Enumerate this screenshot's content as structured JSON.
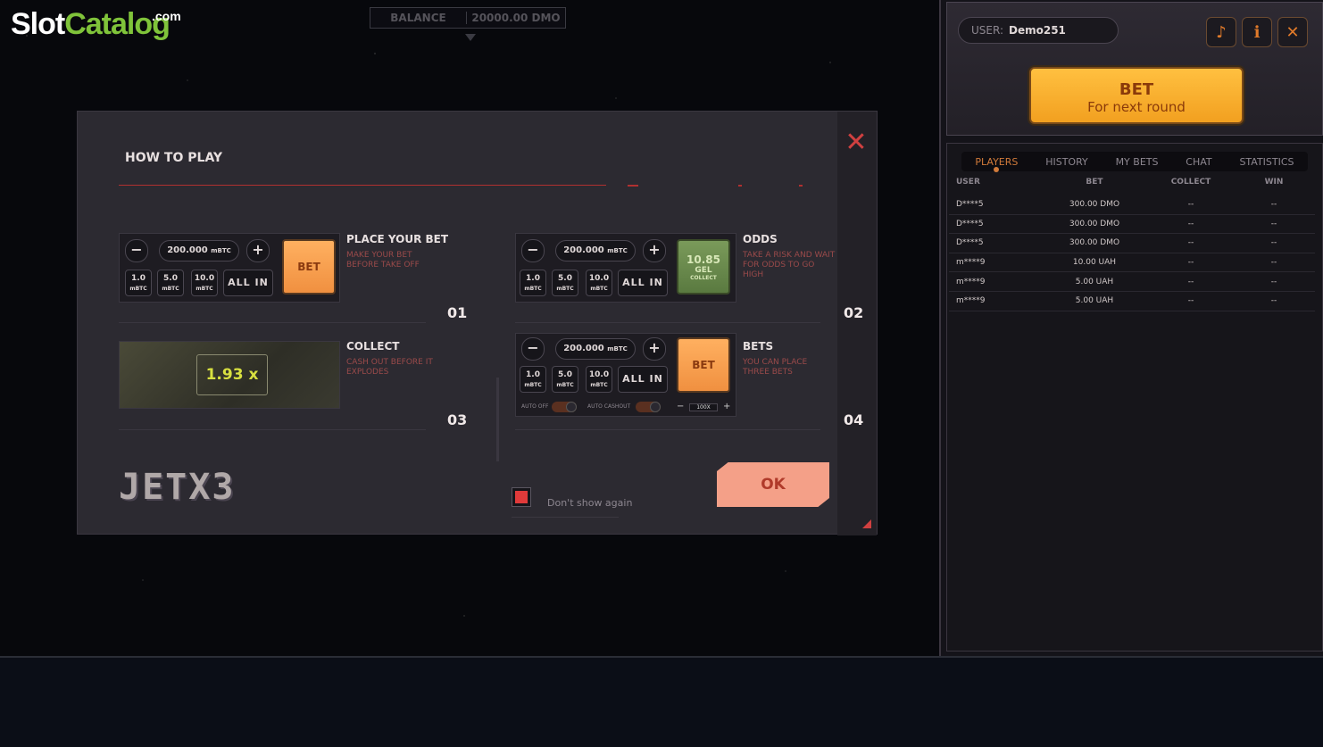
{
  "brand": {
    "slot": "Slot",
    "catalog": "Catalog",
    "com": ".com"
  },
  "balance": {
    "label": "BALANCE",
    "value": "20000.00 DMO"
  },
  "side": {
    "user_label": "USER:",
    "user_value": "Demo251",
    "icons": [
      "speaker-icon",
      "info-icon",
      "close-icon"
    ],
    "bet_title": "BET",
    "bet_sub": "For next round",
    "tabs": [
      "PLAYERS",
      "HISTORY",
      "MY BETS",
      "CHAT",
      "STATISTICS"
    ],
    "columns": [
      "USER",
      "BET",
      "COLLECT",
      "WIN"
    ],
    "rows": [
      [
        "D****5",
        "300.00 DMO",
        "--",
        "--"
      ],
      [
        "D****5",
        "300.00 DMO",
        "--",
        "--"
      ],
      [
        "D****5",
        "300.00 DMO",
        "--",
        "--"
      ],
      [
        "m****9",
        "10.00 UAH",
        "--",
        "--"
      ],
      [
        "m****9",
        "5.00 UAH",
        "--",
        "--"
      ],
      [
        "m****9",
        "5.00 UAH",
        "--",
        "--"
      ]
    ]
  },
  "modal": {
    "title": "HOW TO PLAY",
    "amount": "200.000",
    "amount_unit": "mBTC",
    "chips": [
      {
        "v": "1.0",
        "u": "mBTC"
      },
      {
        "v": "5.0",
        "u": "mBTC"
      },
      {
        "v": "10.0",
        "u": "mBTC"
      }
    ],
    "all_in": "ALL IN",
    "bet": "BET",
    "odds_btn": {
      "value": "10.85",
      "currency": "GEL",
      "label": "COLLECT"
    },
    "collect_value": "1.93 x",
    "auto_off": "AUTO OFF",
    "auto_cashout": "AUTO CASHOUT",
    "auto_value": "100X",
    "sections": [
      {
        "title": "PLACE YOUR BET",
        "desc": "MAKE YOUR BET BEFORE TAKE OFF",
        "num": "01"
      },
      {
        "title": "ODDS",
        "desc": "TAKE A RISK AND WAIT FOR ODDS TO GO HIGH",
        "num": "02"
      },
      {
        "title": "COLLECT",
        "desc": "CASH OUT BEFORE IT EXPLODES",
        "num": "03"
      },
      {
        "title": "BETS",
        "desc": "YOU CAN PLACE THREE BETS",
        "num": "04"
      }
    ],
    "game_logo": "JETX3",
    "dont_show": "Don't show again",
    "ok": "OK"
  }
}
